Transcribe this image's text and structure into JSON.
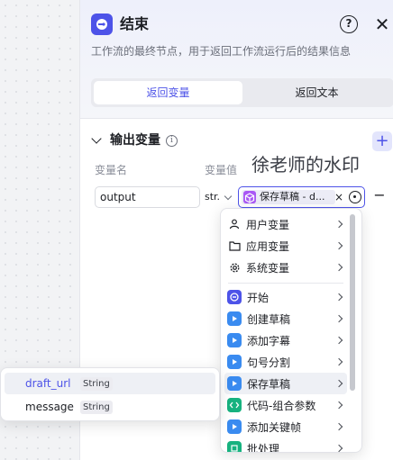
{
  "header": {
    "title": "结束",
    "description": "工作流的最终节点，用于返回工作流运行后的结果信息",
    "accent_color": "#4d53e8",
    "help_icon": "question-circle-icon",
    "close_icon": "close-icon"
  },
  "tabs": [
    {
      "label": "返回变量",
      "active": true
    },
    {
      "label": "返回文本",
      "active": false
    }
  ],
  "output_section": {
    "title": "输出变量",
    "col_name_label": "变量名",
    "col_value_label": "变量值",
    "watermark": "徐老师的水印",
    "row": {
      "name": "output",
      "type": "str.",
      "ref_label": "保存草稿 - d...",
      "remove_symbol": "−"
    },
    "add_symbol": "+"
  },
  "menu": {
    "items": [
      {
        "label": "用户变量",
        "icon": "user-icon"
      },
      {
        "label": "应用变量",
        "icon": "folder-icon"
      },
      {
        "label": "系统变量",
        "icon": "gear-icon"
      },
      {
        "label": "开始",
        "icon": "start-node-icon"
      },
      {
        "label": "创建草稿",
        "icon": "plugin-icon"
      },
      {
        "label": "添加字幕",
        "icon": "plugin-icon"
      },
      {
        "label": "句号分割",
        "icon": "plugin-icon"
      },
      {
        "label": "保存草稿",
        "icon": "plugin-icon",
        "hover": true
      },
      {
        "label": "代码-组合参数",
        "icon": "code-icon"
      },
      {
        "label": "添加关键帧",
        "icon": "plugin-icon"
      },
      {
        "label": "批处理",
        "icon": "batch-icon"
      }
    ]
  },
  "submenu": {
    "items": [
      {
        "name": "draft_url",
        "type": "String",
        "hover": true
      },
      {
        "name": "message",
        "type": "String",
        "hover": false
      }
    ]
  }
}
